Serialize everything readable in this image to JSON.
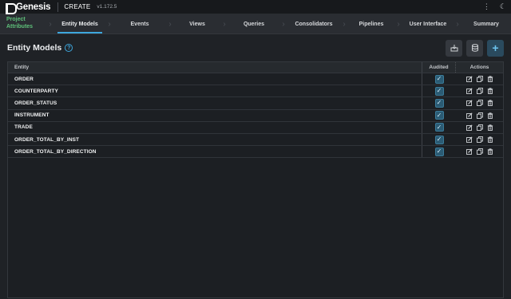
{
  "topbar": {
    "brand": "Genesis",
    "app_name": "CREATE",
    "version": "v1.172.5",
    "icons": [
      "more-vertical-icon",
      "moon-icon"
    ]
  },
  "stepper": {
    "steps": [
      {
        "label": "Project\nAttributes",
        "state": "done"
      },
      {
        "label": "Entity Models",
        "state": "active"
      },
      {
        "label": "Events",
        "state": "pending"
      },
      {
        "label": "Views",
        "state": "pending"
      },
      {
        "label": "Queries",
        "state": "pending"
      },
      {
        "label": "Consolidators",
        "state": "pending"
      },
      {
        "label": "Pipelines",
        "state": "pending"
      },
      {
        "label": "User Interface",
        "state": "pending"
      },
      {
        "label": "Summary",
        "state": "pending"
      }
    ]
  },
  "header": {
    "title": "Entity Models",
    "help": "?",
    "buttons": [
      "import-icon",
      "database-icon",
      "add-icon"
    ]
  },
  "table": {
    "columns": {
      "entity": "Entity",
      "audited": "Audited",
      "actions": "Actions"
    },
    "rows": [
      {
        "entity": "ORDER",
        "audited": true
      },
      {
        "entity": "COUNTERPARTY",
        "audited": true
      },
      {
        "entity": "ORDER_STATUS",
        "audited": true
      },
      {
        "entity": "INSTRUMENT",
        "audited": true
      },
      {
        "entity": "TRADE",
        "audited": true
      },
      {
        "entity": "ORDER_TOTAL_BY_INST",
        "audited": true
      },
      {
        "entity": "ORDER_TOTAL_BY_DIRECTION",
        "audited": true
      }
    ],
    "row_actions": [
      "edit-icon",
      "copy-icon",
      "delete-icon"
    ]
  },
  "colors": {
    "accent": "#3da7dd",
    "done_step": "#5ec07a",
    "background": "#1f2226"
  }
}
